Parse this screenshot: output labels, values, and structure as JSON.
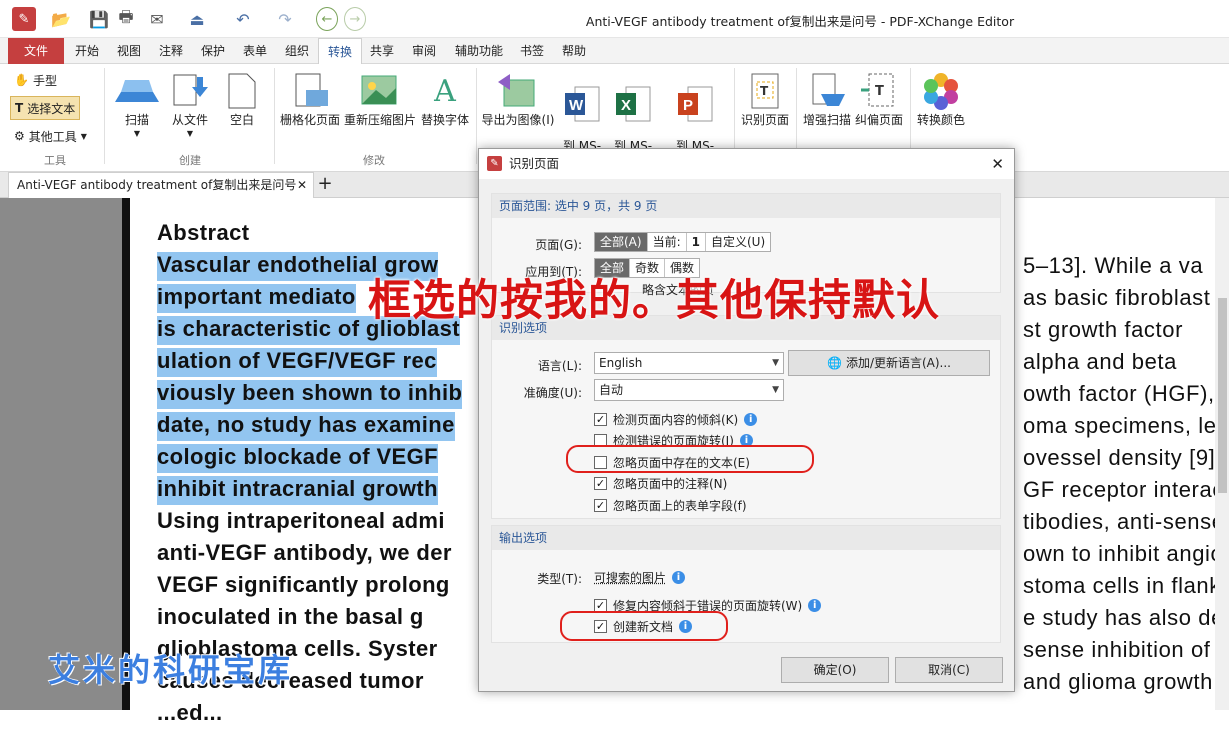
{
  "window": {
    "title": "Anti-VEGF antibody treatment of复制出来是问号 - PDF-XChange Editor"
  },
  "menu": {
    "tabs": [
      "文件",
      "开始",
      "视图",
      "注释",
      "保护",
      "表单",
      "组织",
      "转换",
      "共享",
      "审阅",
      "辅助功能",
      "书签",
      "帮助"
    ],
    "active": "转换"
  },
  "ribbon": {
    "tools": {
      "hand": "手型",
      "select_text": "选择文本",
      "other_tools": "其他工具",
      "group": "工具"
    },
    "create": {
      "scan": "扫描",
      "from_file": "从文件",
      "blank": "空白",
      "group": "创建"
    },
    "modify": {
      "rasterize": "栅格化页面",
      "recompress": "重新压缩图片",
      "replace_fonts": "替换字体",
      "group": "修改"
    },
    "export": {
      "to_image": "导出为图像(I)",
      "to_word": "到 MS-\nWord",
      "to_excel": "到 MS-\nExcel",
      "to_ppt": "到 MS-\nPowerPoint"
    },
    "ocr": {
      "recognize": "识别页面",
      "enhance_scan": "增强扫描",
      "deskew": "纠偏页面",
      "convert_colors": "转换颜色"
    }
  },
  "doc_tab": {
    "title": "Anti-VEGF antibody treatment of复制出来是问号",
    "close": "✕",
    "add": "+"
  },
  "document": {
    "heading": "Abstract",
    "left_lines": [
      {
        "text": "Vascular endothelial grow",
        "hl": true
      },
      {
        "text": "important mediato",
        "hl": true
      },
      {
        "text": "is characteristic of glioblast",
        "hl": true
      },
      {
        "text": "ulation of VEGF/VEGF rec",
        "hl": true
      },
      {
        "text": "viously been shown to inhib",
        "hl": true
      },
      {
        "text": "date, no study has examine",
        "hl": true
      },
      {
        "text": "cologic blockade of VEGF",
        "hl": true
      },
      {
        "text": "inhibit intracranial growth",
        "hl": true
      },
      {
        "text": "Using intraperitoneal admi",
        "hl": false
      },
      {
        "text": "anti-VEGF antibody, we der",
        "hl": false
      },
      {
        "text": "VEGF significantly prolong",
        "hl": false
      },
      {
        "text": "inoculated in the basal g",
        "hl": false
      },
      {
        "text": "glioblastoma cells. Syster",
        "hl": false
      },
      {
        "text": "causes decreased tumor",
        "hl": false
      },
      {
        "text": "...ed...",
        "hl": false
      }
    ],
    "right_lines": [
      "5–13]. While a va",
      "as basic fibroblast",
      "st growth factor",
      "alpha and beta",
      "owth factor (HGF),",
      "oma specimens, lev",
      "ovessel density [9].",
      "GF receptor interac",
      "tibodies, anti-sense",
      "own to inhibit angio",
      "stoma cells in flank",
      "e study has also de",
      "sense inhibition of V",
      "and glioma growth"
    ]
  },
  "dialog": {
    "title": "识别页面",
    "range_header": "页面范围: 选中 9 页，共 9 页",
    "pages_label": "页面(G):",
    "pages_options": [
      "全部(A)",
      "当前:",
      "1",
      "自定义(U)"
    ],
    "apply_label": "应用到(T):",
    "apply_options": [
      "全部",
      "奇数",
      "偶数"
    ],
    "hidden_option": "略含文本的页",
    "ocr_header": "识别选项",
    "language_label": "语言(L):",
    "language_value": "English",
    "add_language": "添加/更新语言(A)...",
    "accuracy_label": "准确度(U):",
    "accuracy_value": "自动",
    "checks": [
      {
        "label": "检测页面内容的倾斜(K)",
        "checked": true,
        "info": true
      },
      {
        "label": "检测错误的页面旋转(I)",
        "checked": false,
        "info": true
      },
      {
        "label": "忽略页面中存在的文本(E)",
        "checked": false,
        "info": false
      },
      {
        "label": "忽略页面中的注释(N)",
        "checked": true,
        "info": false
      },
      {
        "label": "忽略页面上的表单字段(f)",
        "checked": true,
        "info": false
      }
    ],
    "output_header": "输出选项",
    "type_label": "类型(T):",
    "type_value": "可搜索的图片",
    "output_checks": [
      {
        "label": "修复内容倾斜于错误的页面旋转(W)",
        "checked": true,
        "info": true
      },
      {
        "label": "创建新文档",
        "checked": true,
        "info": true
      }
    ],
    "ok": "确定(O)",
    "cancel": "取消(C)",
    "close": "✕"
  },
  "overlay": {
    "instruction": "框选的按我的。其他保持默认",
    "watermark": "艾米的科研宝库"
  },
  "colors": {
    "file_tab": "#c53f3f",
    "highlight": "#92c5f0",
    "annotation_red": "#e0201c",
    "watermark_blue": "#3c7fe0"
  }
}
